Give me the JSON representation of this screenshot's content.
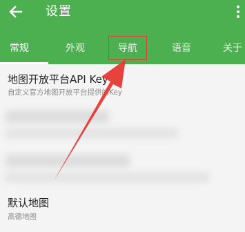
{
  "header": {
    "title": "设置"
  },
  "tabs": [
    {
      "label": "常规"
    },
    {
      "label": "外观"
    },
    {
      "label": "导航"
    },
    {
      "label": "语音"
    },
    {
      "label": "关于"
    }
  ],
  "settings": {
    "api_key_title": "地图开放平台API Key",
    "api_key_desc": "自定义官方地图开放平台提供的Key",
    "default_map_title": "默认地图",
    "default_map_value": "高德地图"
  },
  "colors": {
    "appbar": "#4caf50",
    "annotation": "#e53935",
    "background": "#f4f4f4"
  }
}
